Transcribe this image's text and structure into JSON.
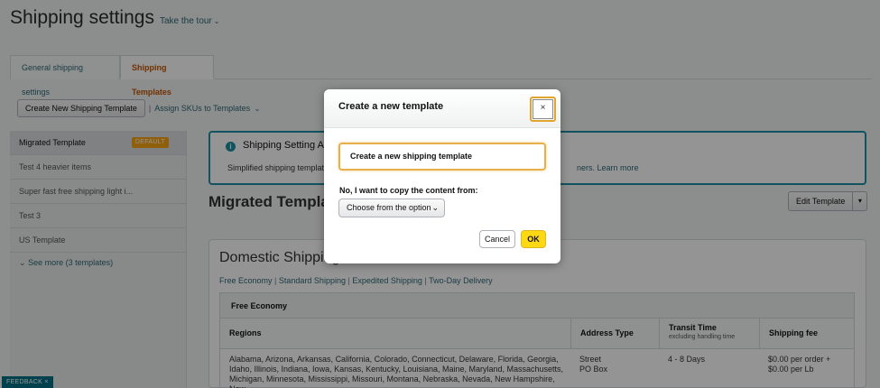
{
  "header": {
    "title": "Shipping settings",
    "tour_link": "Take the tour"
  },
  "tabs": [
    {
      "label": "General shipping settings"
    },
    {
      "label": "Shipping Templates"
    }
  ],
  "actions": {
    "create_button": "Create New Shipping Template",
    "separator": "|",
    "assign_link": "Assign SKUs to Templates"
  },
  "sidebar": {
    "items": [
      {
        "label": "Migrated Template",
        "badge": "DEFAULT"
      },
      {
        "label": "Test 4 heavier items"
      },
      {
        "label": "Super fast free shipping light i..."
      },
      {
        "label": "Test 3"
      },
      {
        "label": "US Template"
      }
    ],
    "see_more": "See more (3 templates)"
  },
  "info": {
    "title": "Shipping Setting Au",
    "text": "Simplified shipping template",
    "text_tail": "ners.",
    "learn_more": "Learn more"
  },
  "main": {
    "section_title": "Migrated Templat",
    "edit_button": "Edit Template"
  },
  "domestic": {
    "title": "Domestic Shipping",
    "links": [
      "Free Economy",
      "Standard Shipping",
      "Expedited Shipping",
      "Two-Day Delivery"
    ],
    "link_separator": "|",
    "table": {
      "group_title": "Free Economy",
      "headers": {
        "regions": "Regions",
        "address_type": "Address Type",
        "transit_time": "Transit Time",
        "transit_note": "excluding handling time",
        "shipping_fee": "Shipping fee"
      },
      "row": {
        "regions_line1": "Alabama, Arizona, Arkansas, California, Colorado, Connecticut, Delaware, Florida, Georgia,",
        "regions_line2": "Idaho, Illinois, Indiana, Iowa, Kansas, Kentucky, Louisiana, Maine, Maryland, Massachusetts,",
        "regions_line3": "Michigan, Minnesota, Mississippi, Missouri, Montana, Nebraska, Nevada, New Hampshire, New",
        "address_line1": "Street",
        "address_line2": "PO Box",
        "transit": "4 - 8 Days",
        "fee_line1": "$0.00 per order +",
        "fee_line2": "$0.00 per Lb"
      }
    }
  },
  "feedback": {
    "label": "FEEDBACK",
    "close": "×"
  },
  "modal": {
    "title": "Create a new template",
    "close": "×",
    "input_value": "Create a new shipping template",
    "copy_label": "No, I want to copy the content from:",
    "select_value": "Choose from the option",
    "cancel": "Cancel",
    "ok": "OK"
  },
  "colors": {
    "accent": "#1e8fa3",
    "link": "#2d6775",
    "ok_button": "#ffd814",
    "badge": "#f6a416",
    "active_tab": "#c45500"
  }
}
